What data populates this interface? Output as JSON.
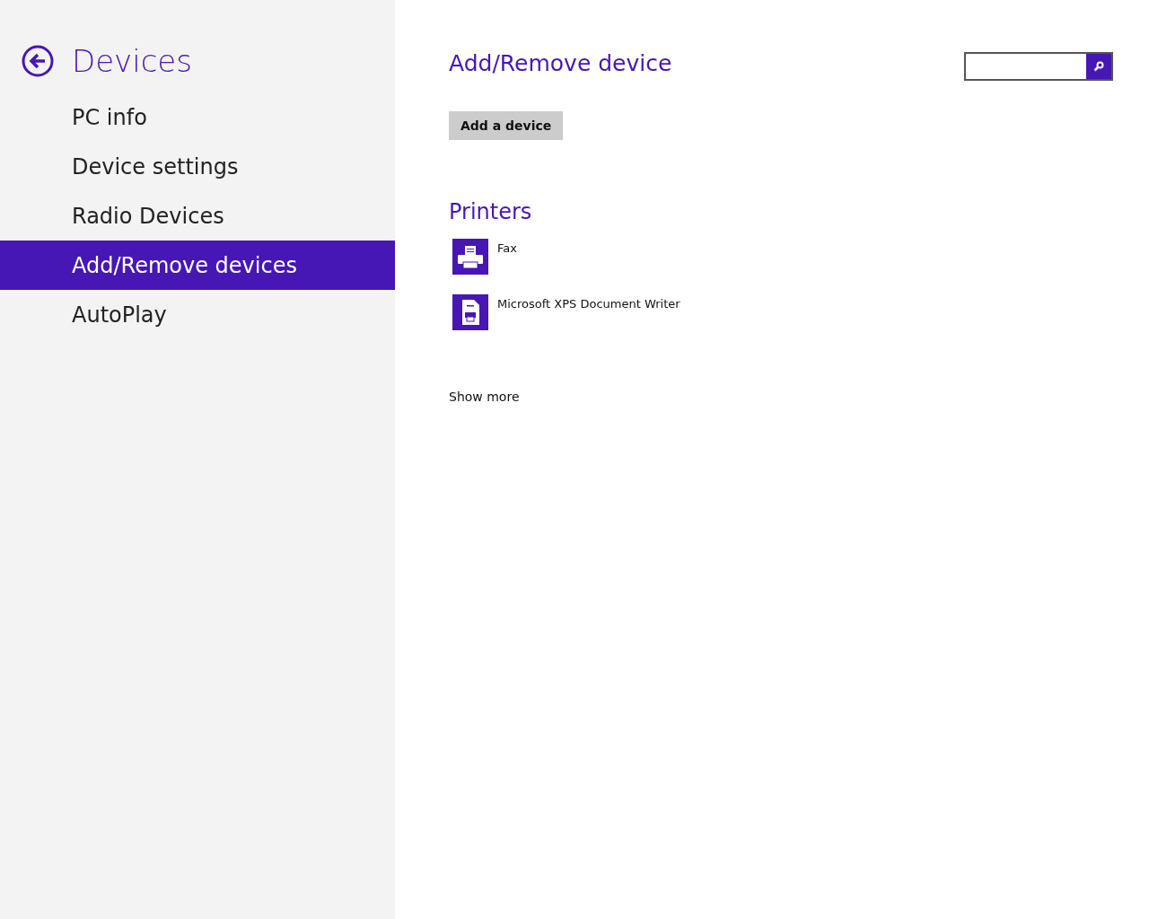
{
  "sidebar": {
    "title": "Devices",
    "items": [
      {
        "label": "PC info",
        "selected": false
      },
      {
        "label": "Device settings",
        "selected": false
      },
      {
        "label": "Radio Devices",
        "selected": false
      },
      {
        "label": "Add/Remove devices",
        "selected": true
      },
      {
        "label": "AutoPlay",
        "selected": false
      }
    ]
  },
  "main": {
    "title": "Add/Remove device",
    "add_button": "Add a device",
    "section_title": "Printers",
    "printers": [
      {
        "kind": "fax",
        "name": "Fax"
      },
      {
        "kind": "document",
        "name": "Microsoft XPS Document Writer"
      }
    ],
    "show_more": "Show more"
  }
}
